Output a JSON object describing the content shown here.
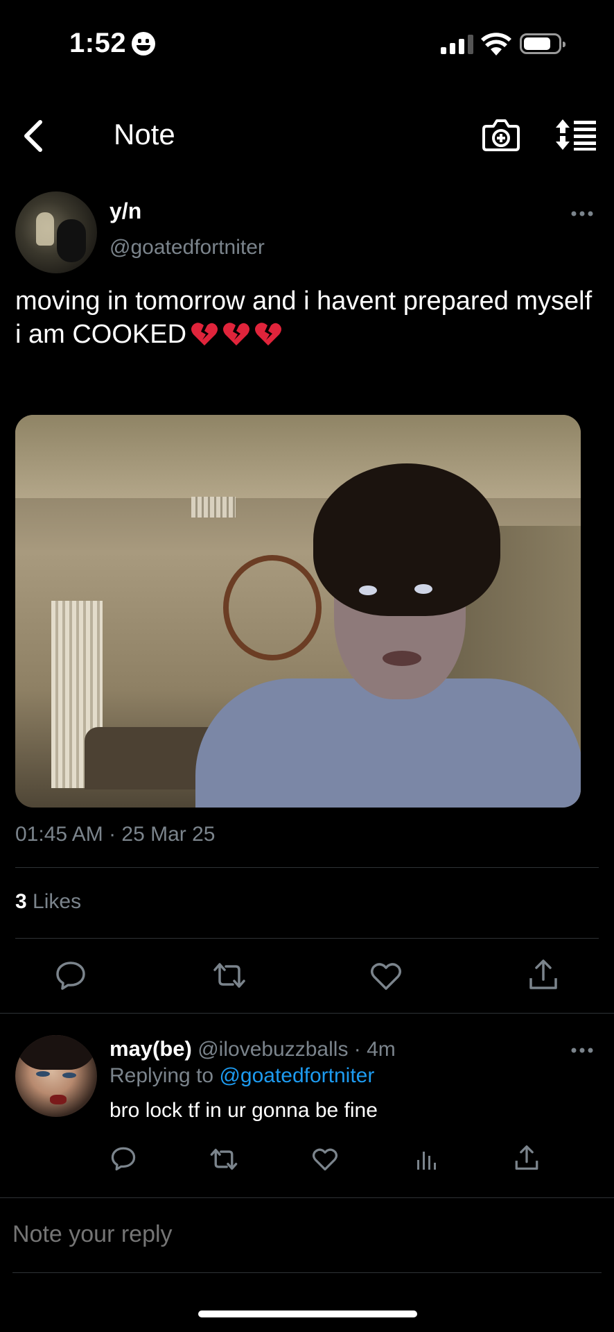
{
  "status_bar": {
    "time": "1:52"
  },
  "nav": {
    "title": "Note"
  },
  "tweet": {
    "display_name": "y/n",
    "handle": "@goatedfortniter",
    "text_line1": "moving in tomorrow and i havent prepared myself",
    "text_line2": "i am COOKED",
    "emoji_count": 3,
    "timestamp": "01:45 AM · 25 Mar 25",
    "likes_count": "3",
    "likes_label": "Likes"
  },
  "reply": {
    "display_name": "may(be)",
    "meta": "@ilovebuzzballs · 4m",
    "replying_label": "Replying to",
    "replying_to": "@goatedfortniter",
    "text": "bro lock tf in ur gonna be fine"
  },
  "composer": {
    "placeholder": "Note your reply"
  },
  "colors": {
    "background": "#000000",
    "secondary_text": "#7b848c",
    "link": "#1d9bf0",
    "divider": "#2f3336",
    "broken_heart": "#e0243b"
  }
}
